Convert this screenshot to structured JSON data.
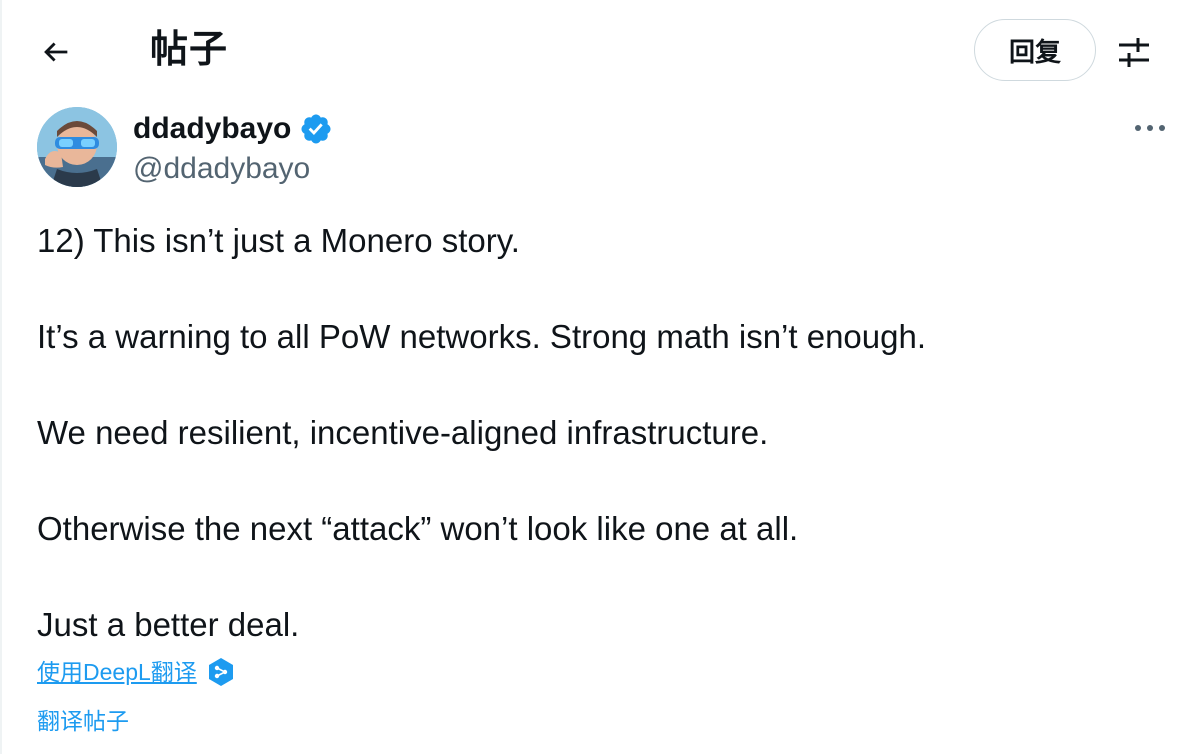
{
  "header": {
    "title": "帖子",
    "reply_label": "回复",
    "back_icon": "arrow-left-icon",
    "adjust_icon": "sliders-icon"
  },
  "author": {
    "display_name": "ddadybayo",
    "handle": "@ddadybayo",
    "verified": true,
    "verified_color": "#1d9bf0"
  },
  "tweet": {
    "lines": [
      "12) This isn’t just a Monero story.",
      "It’s a warning to all PoW networks. Strong math isn’t enough.",
      "We need resilient, incentive-aligned infrastructure.",
      "Otherwise the next “attack” won’t look like one at all.",
      "Just a better deal."
    ]
  },
  "actions": {
    "deepl_label": "使用DeepL翻译",
    "translate_label": "翻译帖子"
  },
  "colors": {
    "accent": "#1d9bf0",
    "text": "#0f1419",
    "secondary": "#536471"
  }
}
